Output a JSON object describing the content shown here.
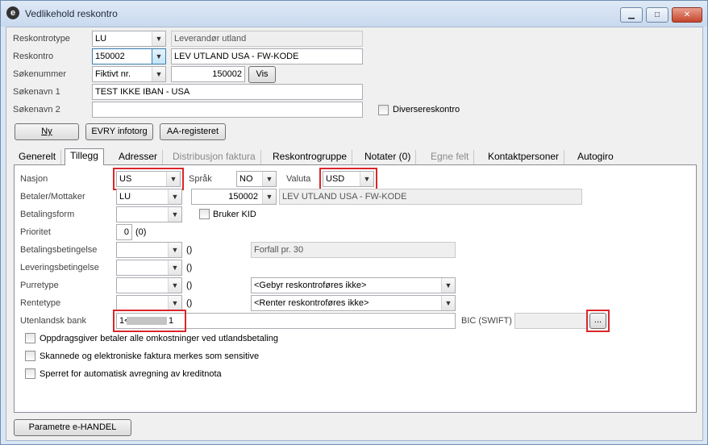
{
  "window": {
    "title": "Vedlikehold reskontro",
    "icon": "app-e-icon",
    "buttons": {
      "minimize": "▁",
      "maximize": "□",
      "close": "✕"
    }
  },
  "header": {
    "reskontrotype": {
      "label": "Reskontrotype",
      "value": "LU",
      "description": "Leverandør utland"
    },
    "reskontro": {
      "label": "Reskontro",
      "value": "150002",
      "name": "LEV UTLAND USA  - FW-KODE"
    },
    "sokenummer": {
      "label": "Søkenummer",
      "type_value": "Fiktivt nr.",
      "number": "150002",
      "vis_button": "Vis"
    },
    "sokenavn1": {
      "label": "Søkenavn 1",
      "value": "TEST IKKE IBAN - USA"
    },
    "sokenavn2": {
      "label": "Søkenavn 2",
      "value": ""
    },
    "diversereskontro": {
      "label": "Diversereskontro",
      "checked": false
    },
    "buttons": {
      "ny": "Ny",
      "evry": "EVRY infotorg",
      "aa": "AA-registeret"
    }
  },
  "tabs": [
    {
      "label": "Generelt",
      "active": false,
      "enabled": true
    },
    {
      "label": "Tillegg",
      "active": true,
      "enabled": true
    },
    {
      "label": "Adresser",
      "active": false,
      "enabled": true
    },
    {
      "label": "Distribusjon faktura",
      "active": false,
      "enabled": false
    },
    {
      "label": "Reskontrogruppe",
      "active": false,
      "enabled": true
    },
    {
      "label": "Notater (0)",
      "active": false,
      "enabled": true
    },
    {
      "label": "Egne felt",
      "active": false,
      "enabled": false
    },
    {
      "label": "Kontaktpersoner",
      "active": false,
      "enabled": true
    },
    {
      "label": "Autogiro",
      "active": false,
      "enabled": true
    }
  ],
  "tillegg": {
    "nasjon": {
      "label": "Nasjon",
      "value": "US"
    },
    "sprak": {
      "label": "Språk",
      "value": "NO"
    },
    "valuta": {
      "label": "Valuta",
      "value": "USD"
    },
    "betaler": {
      "label": "Betaler/Mottaker",
      "type": "LU",
      "number": "150002",
      "name": "LEV UTLAND USA  - FW-KODE"
    },
    "betalingsform": {
      "label": "Betalingsform",
      "value": ""
    },
    "bruker_kid": {
      "label": "Bruker KID",
      "checked": false
    },
    "prioritet": {
      "label": "Prioritet",
      "value": "0",
      "extra": "(0)"
    },
    "betalingsbetingelse": {
      "label": "Betalingsbetingelse",
      "value": "",
      "paren": "()",
      "description": "Forfall pr. 30"
    },
    "leveringsbetingelse": {
      "label": "Leveringsbetingelse",
      "value": "",
      "paren": "()"
    },
    "purretype": {
      "label": "Purretype",
      "value": "",
      "paren": "()",
      "option": "<Gebyr reskontroføres ikke>"
    },
    "rentetype": {
      "label": "Rentetype",
      "value": "",
      "paren": "()",
      "option": "<Renter reskontroføres ikke>"
    },
    "utenlandsk_bank": {
      "label": "Utenlandsk bank",
      "value_start": "1<",
      "value_end": "1"
    },
    "bic": {
      "label": "BIC (SWIFT)",
      "value": "",
      "lookup_button": "..."
    },
    "checkboxes": [
      {
        "label": "Oppdragsgiver betaler alle omkostninger ved utlandsbetaling",
        "checked": false
      },
      {
        "label": "Skannede og elektroniske faktura merkes som sensitive",
        "checked": false
      },
      {
        "label": "Sperret for automatisk avregning av kreditnota",
        "checked": false
      }
    ]
  },
  "footer": {
    "parametre_button": "Parametre e-HANDEL"
  },
  "colors": {
    "highlight": "#d9262b",
    "title_gradient_top": "#dfe9f6",
    "panel_bg": "#f0f0f0"
  }
}
